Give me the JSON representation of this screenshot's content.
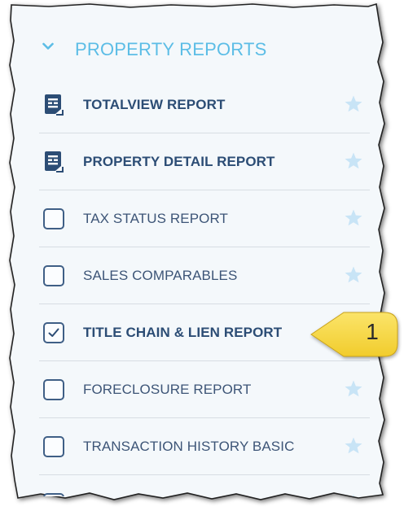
{
  "section": {
    "title": "PROPERTY REPORTS",
    "chevron_icon": "chevron-down-icon"
  },
  "colors": {
    "header_blue": "#5cbde6",
    "label_navy": "#2c4d75",
    "star_light_blue": "#c8e4f6",
    "callout_yellow": "#f5d642"
  },
  "items": [
    {
      "label": "TOTALVIEW REPORT",
      "type": "report-icon",
      "checked": false,
      "bold": true
    },
    {
      "label": "PROPERTY DETAIL REPORT",
      "type": "report-icon",
      "checked": false,
      "bold": true
    },
    {
      "label": "TAX STATUS REPORT",
      "type": "checkbox",
      "checked": false,
      "bold": false
    },
    {
      "label": "SALES COMPARABLES",
      "type": "checkbox",
      "checked": false,
      "bold": false
    },
    {
      "label": "TITLE CHAIN & LIEN REPORT",
      "type": "checkbox",
      "checked": true,
      "bold": true
    },
    {
      "label": "FORECLOSURE REPORT",
      "type": "checkbox",
      "checked": false,
      "bold": false
    },
    {
      "label": "TRANSACTION HISTORY BASIC",
      "type": "checkbox",
      "checked": false,
      "bold": false
    }
  ],
  "callout": {
    "number": "1"
  }
}
